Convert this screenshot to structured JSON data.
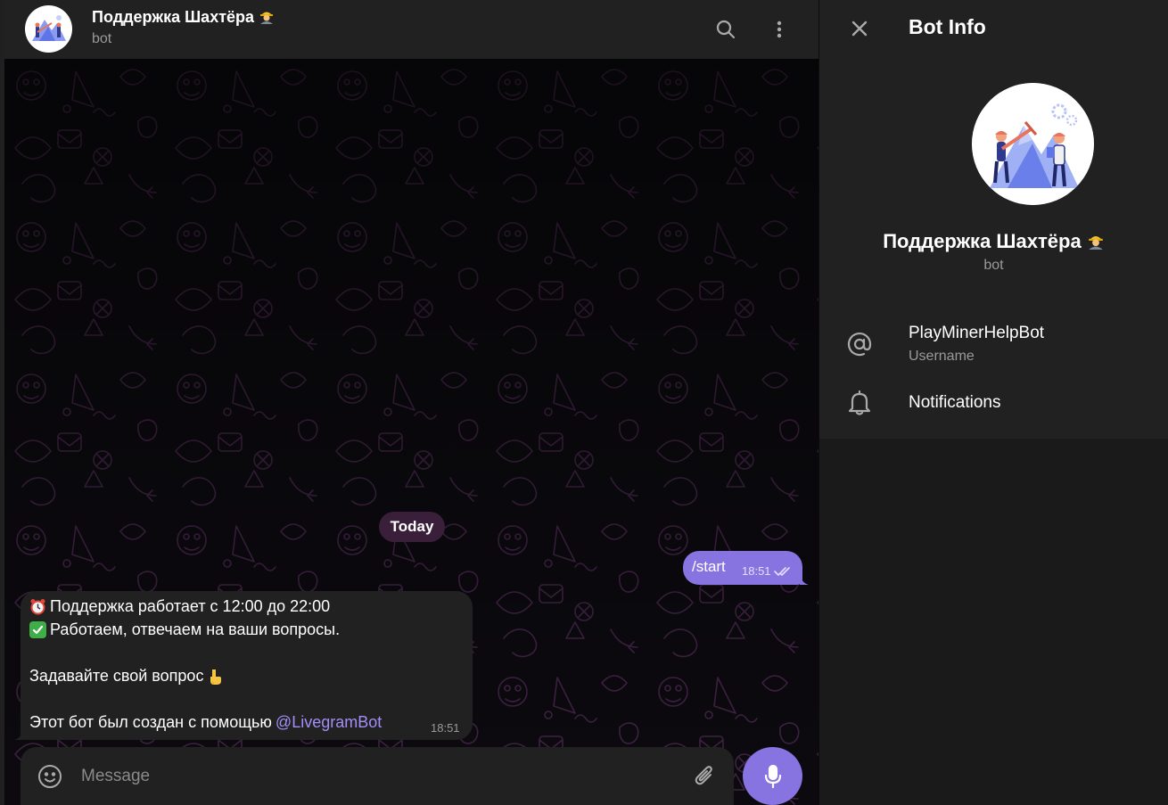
{
  "chat": {
    "title": "Поддержка Шахтёра",
    "status": "bot",
    "date_separator": "Today",
    "outgoing": {
      "text": "/start",
      "time": "18:51",
      "read": true
    },
    "incoming": {
      "line1": "Поддержка работает с 12:00 до 22:00",
      "line2": "Работаем, отвечаем на ваши вопросы.",
      "line3": "Задавайте свой вопрос",
      "line4": "Этот бот был создан с помощью",
      "link": "@LivegramBot",
      "time": "18:51"
    },
    "composer": {
      "placeholder": "Message"
    }
  },
  "panel": {
    "title": "Bot Info",
    "name": "Поддержка Шахтёра",
    "status": "bot",
    "username_value": "PlayMinerHelpBot",
    "username_label": "Username",
    "notifications_label": "Notifications"
  },
  "icons": {
    "search": "search-icon",
    "more": "more-vertical-icon",
    "close": "close-icon",
    "at": "at-sign-icon",
    "bell": "bell-icon",
    "emoji": "smile-icon",
    "attach": "paperclip-icon",
    "mic": "microphone-icon",
    "alarm": "alarm-clock-emoji",
    "check": "check-mark-emoji",
    "point_down": "pointing-down-emoji",
    "worker": "construction-worker-emoji",
    "read_checks": "double-check-icon"
  },
  "colors": {
    "accent": "#8774e1",
    "header_bg": "#212121",
    "panel_bg": "#212121",
    "chat_bg": "#0c0a0f",
    "date_pill": "#3a1f3b",
    "link": "#a38ef7",
    "muted_text": "#9a9a9a"
  }
}
